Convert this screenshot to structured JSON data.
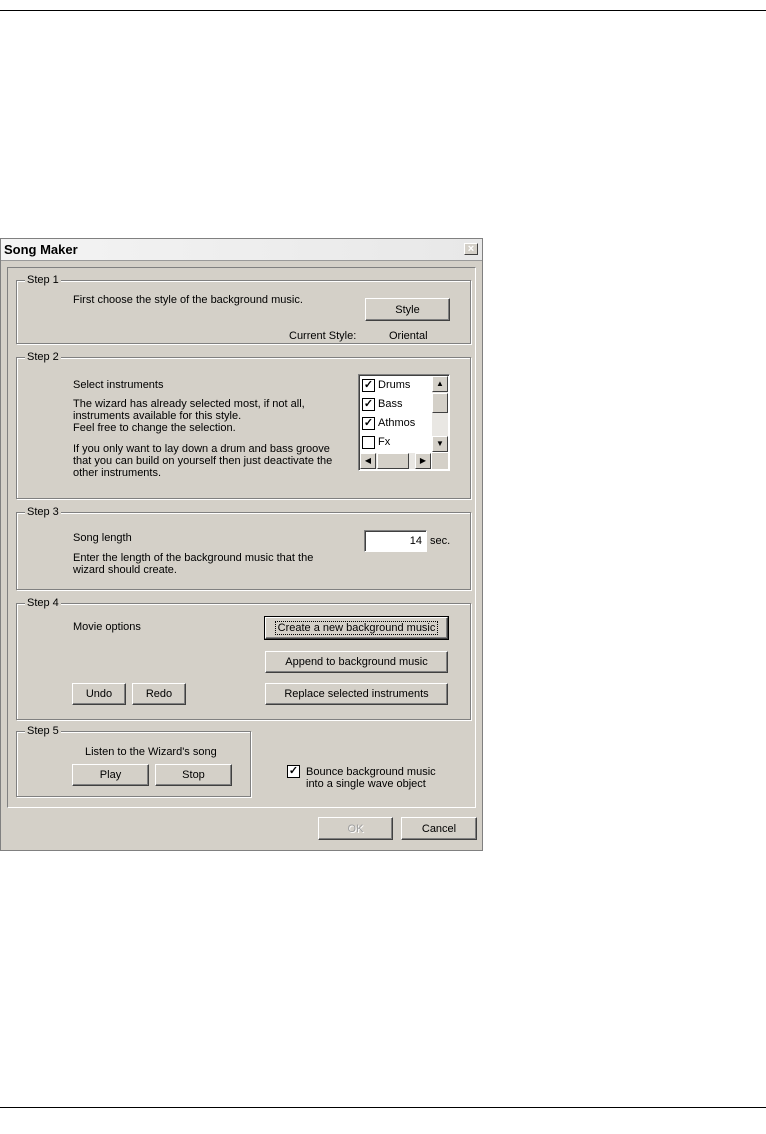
{
  "window": {
    "title": "Song Maker",
    "close_glyph": "×"
  },
  "step1": {
    "label": "Step 1",
    "description": "First choose the style of the background music.",
    "style_button": "Style",
    "current_style_label": "Current Style:",
    "current_style_value": "Oriental"
  },
  "step2": {
    "label": "Step 2",
    "heading": "Select instruments",
    "desc_line1": "The wizard has already selected most, if not all,",
    "desc_line2": "instruments available for this style.",
    "desc_line3": "Feel free to change the selection.",
    "desc_line4": "If you only want to lay down a drum and bass groove",
    "desc_line5": "that you can build on yourself then just deactivate the",
    "desc_line6": "other instruments.",
    "instruments": [
      {
        "name": "Drums",
        "checked": true
      },
      {
        "name": "Bass",
        "checked": true
      },
      {
        "name": "Athmos",
        "checked": true
      },
      {
        "name": "Fx",
        "checked": false
      }
    ],
    "check_glyph": "✓"
  },
  "step3": {
    "label": "Step 3",
    "heading": "Song length",
    "desc_line1": "Enter the length of the background music that the",
    "desc_line2": "wizard should create.",
    "length_value": "14",
    "unit": "sec."
  },
  "step4": {
    "label": "Step 4",
    "heading": "Movie options",
    "create_button": "Create a new background music",
    "append_button": "Append to background music",
    "replace_button": "Replace selected instruments",
    "undo_button": "Undo",
    "redo_button": "Redo"
  },
  "step5": {
    "label": "Step 5",
    "heading": "Listen to the Wizard's song",
    "play_button": "Play",
    "stop_button": "Stop"
  },
  "bounce": {
    "checked": true,
    "line1": "Bounce background music",
    "line2": "into a single wave object"
  },
  "footer": {
    "ok_button": "OK",
    "cancel_button": "Cancel"
  },
  "scroll_glyphs": {
    "up": "▲",
    "down": "▼",
    "left": "◀",
    "right": "▶"
  }
}
